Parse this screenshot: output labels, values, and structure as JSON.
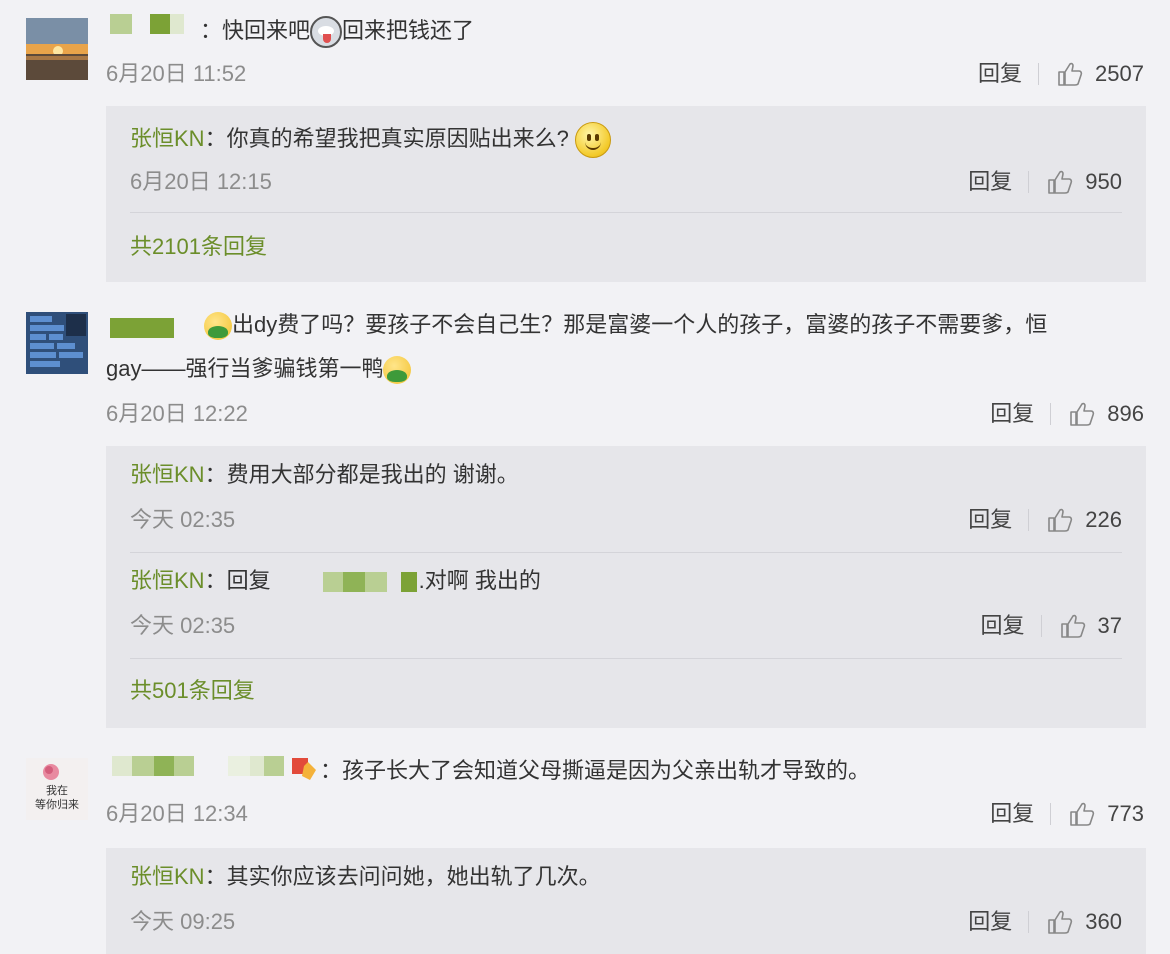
{
  "comments": [
    {
      "colon": "：",
      "text_a": "快回来吧",
      "text_b": "回来把钱还了",
      "time": "6月20日 11:52",
      "reply_label": "回复",
      "likes": "2507",
      "replies": [
        {
          "name": "张恒KN",
          "sep": "：",
          "text": "你真的希望我把真实原因贴出来么?",
          "time": "6月20日 12:15",
          "reply_label": "回复",
          "likes": "950"
        }
      ],
      "more": "共2101条回复"
    },
    {
      "avatar_lines": [
        "空手套4千",
        "gay骗财骗色",
        "恶臭",
        "协商离婚",
        "诉讼前",
        "出轨",
        ""
      ],
      "text_line1": "出dy费了吗？要孩子不会自己生？那是富婆一个人的孩子，富婆的孩子不需要爹，恒",
      "text_line2": "gay——强行当爹骗钱第一鸭",
      "time": "6月20日 12:22",
      "reply_label": "回复",
      "likes": "896",
      "replies": [
        {
          "name": "张恒KN",
          "sep": "：",
          "text": "费用大部分都是我出的 谢谢。",
          "time": "今天 02:35",
          "reply_label": "回复",
          "likes": "226"
        },
        {
          "name": "张恒KN",
          "sep": "：",
          "text_pre": "回复",
          "text": ".对啊 我出的",
          "time": "今天 02:35",
          "reply_label": "回复",
          "likes": "37"
        }
      ],
      "more": "共501条回复"
    },
    {
      "avatar_text_1": "我在",
      "avatar_text_2": "等你归来",
      "colon": "：",
      "text": "孩子长大了会知道父母撕逼是因为父亲出轨才导致的。",
      "time": "6月20日 12:34",
      "reply_label": "回复",
      "likes": "773",
      "replies": [
        {
          "name": "张恒KN",
          "sep": "：",
          "text": "其实你应该去问问她，她出轨了几次。",
          "time": "今天 09:25",
          "reply_label": "回复",
          "likes": "360"
        }
      ]
    }
  ],
  "colors": {
    "name_green": "#6b8e2a",
    "reply_bg": "#e6e6ea",
    "page_bg": "#f2f2f5"
  }
}
